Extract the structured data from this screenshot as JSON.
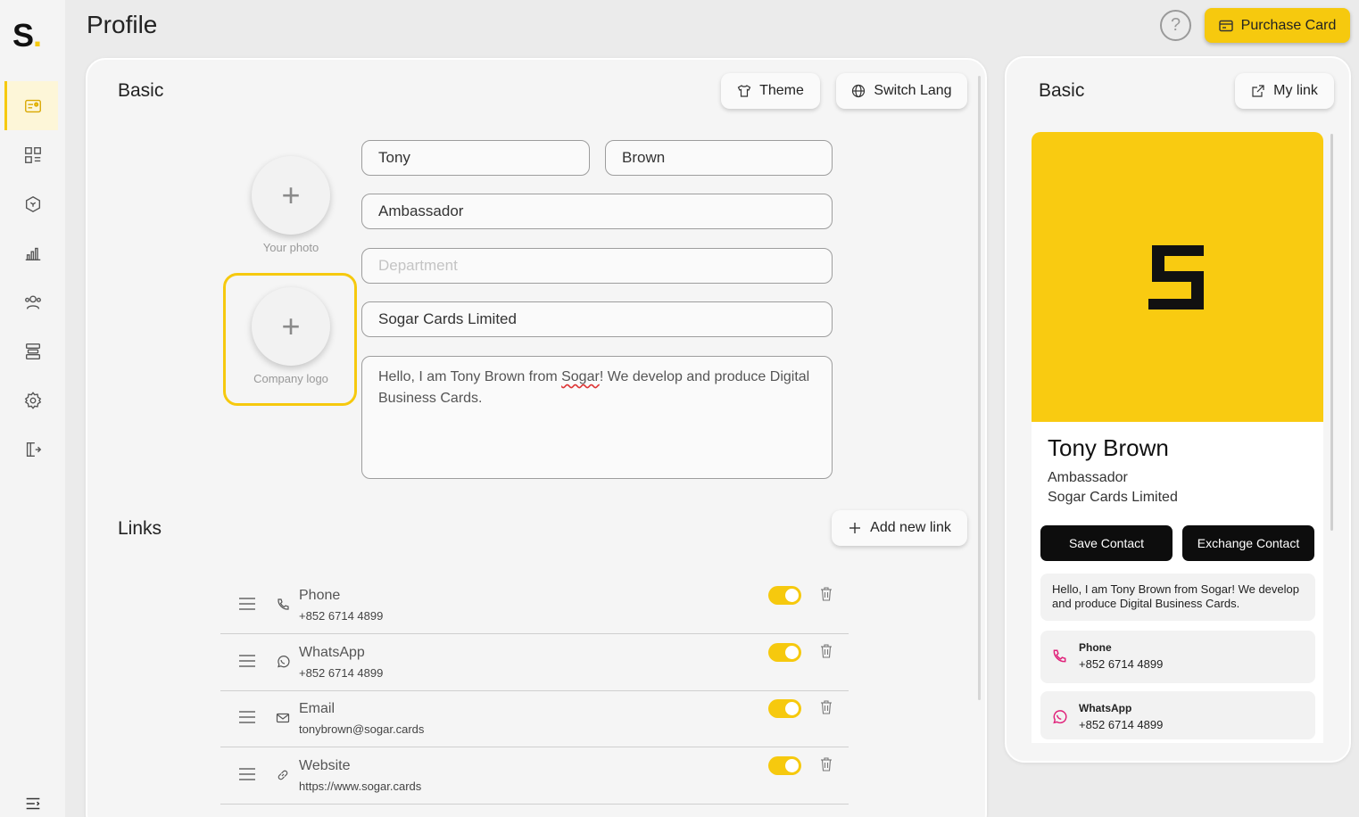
{
  "app": {
    "logo_letter": "S",
    "logo_dot": "."
  },
  "header": {
    "title": "Profile",
    "help_label": "?",
    "purchase_label": "Purchase Card"
  },
  "colors": {
    "accent": "#f6c90e",
    "card_banner": "#f9cb11",
    "icon_pink": "#e0217a"
  },
  "sidebar": {
    "items": [
      {
        "icon": "profile-card-icon",
        "active": true
      },
      {
        "icon": "apps-grid-icon"
      },
      {
        "icon": "cube-icon"
      },
      {
        "icon": "analytics-icon"
      },
      {
        "icon": "contacts-icon"
      },
      {
        "icon": "server-icon"
      },
      {
        "icon": "settings-icon"
      },
      {
        "icon": "logout-icon"
      }
    ],
    "bottom_icon": "menu-collapse-icon"
  },
  "basic": {
    "title": "Basic",
    "theme_label": "Theme",
    "switch_lang_label": "Switch Lang",
    "photo_label": "Your photo",
    "logo_label": "Company logo",
    "first_name": "Tony",
    "last_name": "Brown",
    "job_title": "Ambassador",
    "department_placeholder": "Department",
    "company": "Sogar Cards Limited",
    "bio_pre": "Hello, I am Tony Brown from ",
    "bio_marked": "Sogar",
    "bio_post": "!  We develop and produce Digital Business Cards."
  },
  "links": {
    "title": "Links",
    "add_label": "Add new link",
    "items": [
      {
        "label": "Phone",
        "value": "+852 6714 4899",
        "enabled": true,
        "icon": "phone-icon"
      },
      {
        "label": "WhatsApp",
        "value": "+852 6714 4899",
        "enabled": true,
        "icon": "whatsapp-icon"
      },
      {
        "label": "Email",
        "value": "tonybrown@sogar.cards",
        "enabled": true,
        "icon": "email-icon"
      },
      {
        "label": "Website",
        "value": "https://www.sogar.cards",
        "enabled": true,
        "icon": "link-icon"
      }
    ]
  },
  "preview": {
    "title": "Basic",
    "my_link_label": "My link",
    "name": "Tony Brown",
    "role": "Ambassador",
    "company": "Sogar Cards Limited",
    "save_label": "Save Contact",
    "exchange_label": "Exchange Contact",
    "bio": "Hello, I am Tony Brown from Sogar! We develop and produce Digital Business Cards.",
    "links": [
      {
        "label": "Phone",
        "value": "+852 6714 4899"
      },
      {
        "label": "WhatsApp",
        "value": "+852 6714 4899"
      }
    ]
  }
}
